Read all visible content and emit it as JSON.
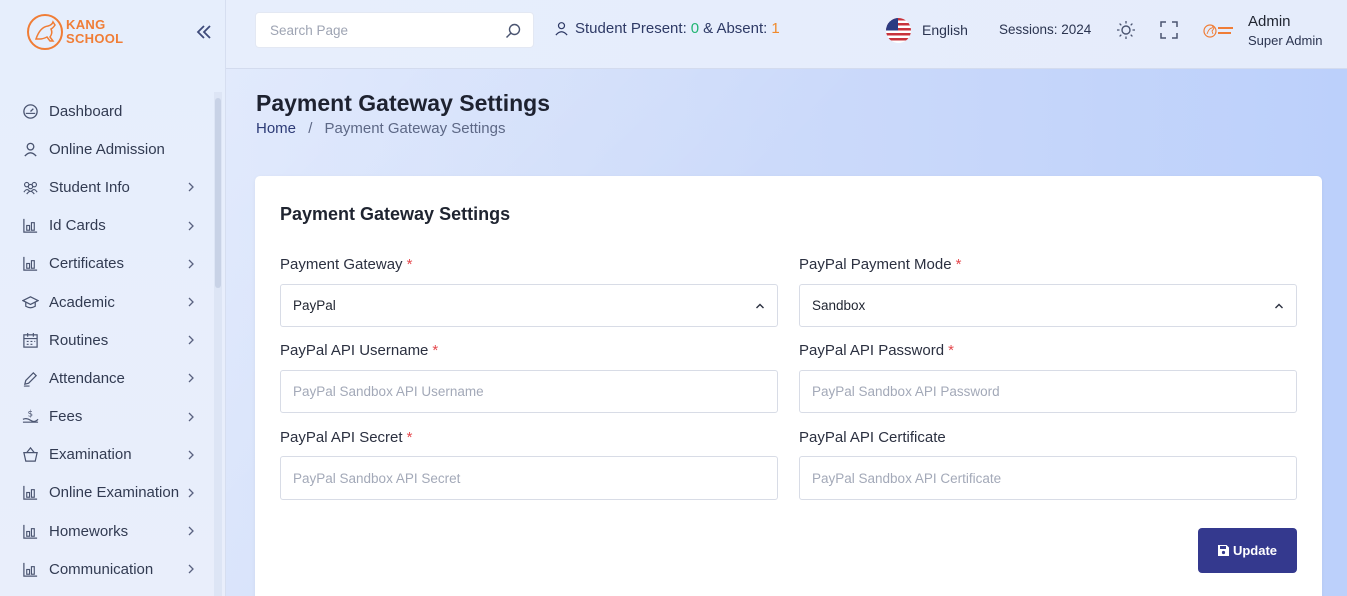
{
  "brand": {
    "line1": "KANG",
    "line2": "SCHOOL"
  },
  "sidebar": {
    "items": [
      {
        "label": "Dashboard",
        "icon": "dashboard-icon",
        "has_children": false
      },
      {
        "label": "Online Admission",
        "icon": "user-icon",
        "has_children": false
      },
      {
        "label": "Student Info",
        "icon": "users-icon",
        "has_children": true
      },
      {
        "label": "Id Cards",
        "icon": "chart-icon",
        "has_children": true
      },
      {
        "label": "Certificates",
        "icon": "chart-icon",
        "has_children": true
      },
      {
        "label": "Academic",
        "icon": "graduation-cap-icon",
        "has_children": true
      },
      {
        "label": "Routines",
        "icon": "calendar-icon",
        "has_children": true
      },
      {
        "label": "Attendance",
        "icon": "pen-icon",
        "has_children": true
      },
      {
        "label": "Fees",
        "icon": "money-icon",
        "has_children": true
      },
      {
        "label": "Examination",
        "icon": "basket-icon",
        "has_children": true
      },
      {
        "label": "Online Examination",
        "icon": "chart-icon",
        "has_children": true
      },
      {
        "label": "Homeworks",
        "icon": "chart-icon",
        "has_children": true
      },
      {
        "label": "Communication",
        "icon": "chart-icon",
        "has_children": true
      }
    ]
  },
  "topbar": {
    "search_placeholder": "Search Page",
    "present_label": "Student Present:",
    "present_value": "0",
    "absent_label": "& Absent:",
    "absent_value": "1",
    "language": "English",
    "sessions": "Sessions: 2024",
    "user_name": "Admin",
    "user_role": "Super Admin"
  },
  "page": {
    "title": "Payment Gateway Settings",
    "breadcrumb_home": "Home",
    "breadcrumb_sep": "/",
    "breadcrumb_current": "Payment Gateway Settings"
  },
  "form": {
    "card_title": "Payment Gateway Settings",
    "gateway": {
      "label": "Payment Gateway",
      "required": "*",
      "value": "PayPal"
    },
    "mode": {
      "label": "PayPal Payment Mode",
      "required": "*",
      "value": "Sandbox"
    },
    "username": {
      "label": "PayPal API Username",
      "required": "*",
      "placeholder": "PayPal Sandbox API Username"
    },
    "password": {
      "label": "PayPal API Password",
      "required": "*",
      "placeholder": "PayPal Sandbox API Password"
    },
    "secret": {
      "label": "PayPal API Secret",
      "required": "*",
      "placeholder": "PayPal Sandbox API Secret"
    },
    "certificate": {
      "label": "PayPal API Certificate",
      "placeholder": "PayPal Sandbox API Certificate"
    },
    "update_label": "Update"
  },
  "colors": {
    "accent": "#34398e",
    "present": "#22b573",
    "absent": "#f08a2c",
    "required": "#e5484d",
    "brand": "#f07d36"
  }
}
